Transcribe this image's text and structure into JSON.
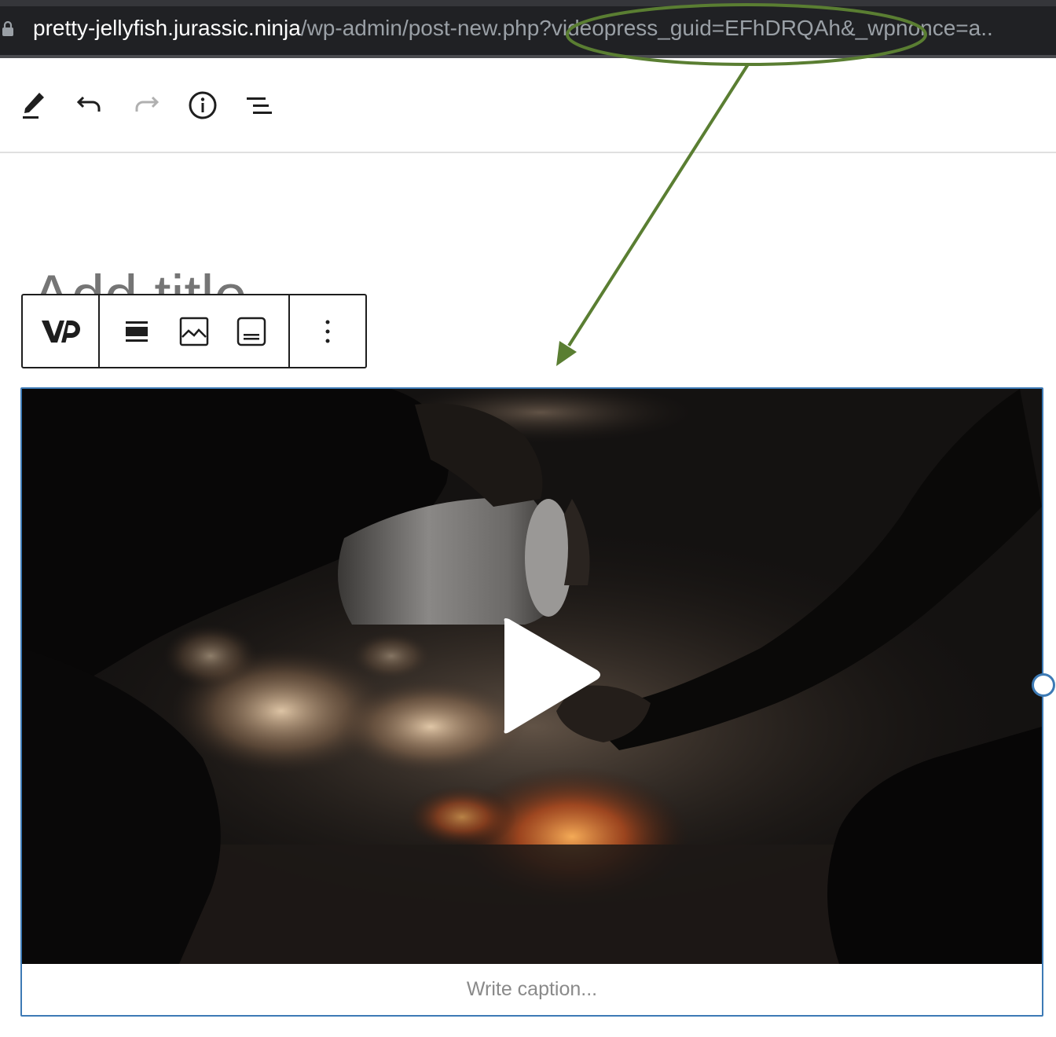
{
  "browser": {
    "url_host": "pretty-jellyfish.jurassic.ninja",
    "url_path": "/wp-admin/post-new.php?videopress_guid=EFhDRQAh&_wpnonce=a..",
    "lock_icon": "lock-icon"
  },
  "editor_toolbar": {
    "tools": [
      {
        "name": "edit-tool",
        "icon": "pencil-icon"
      },
      {
        "name": "undo",
        "icon": "undo-icon"
      },
      {
        "name": "redo",
        "icon": "redo-icon",
        "disabled": true
      },
      {
        "name": "details",
        "icon": "info-icon"
      },
      {
        "name": "list-view",
        "icon": "list-view-icon"
      }
    ]
  },
  "post": {
    "title_placeholder": "Add title"
  },
  "block_toolbar": {
    "block_icon": "videopress-icon",
    "controls": [
      "align-icon",
      "poster-image-icon",
      "caption-icon"
    ],
    "more_icon": "more-options-icon"
  },
  "video_block": {
    "caption_placeholder": "Write caption...",
    "play_icon": "play-icon"
  },
  "colors": {
    "url_bar_bg": "#202124",
    "selection_blue": "#3d7ab5",
    "annotation_green": "#5a7e32"
  }
}
